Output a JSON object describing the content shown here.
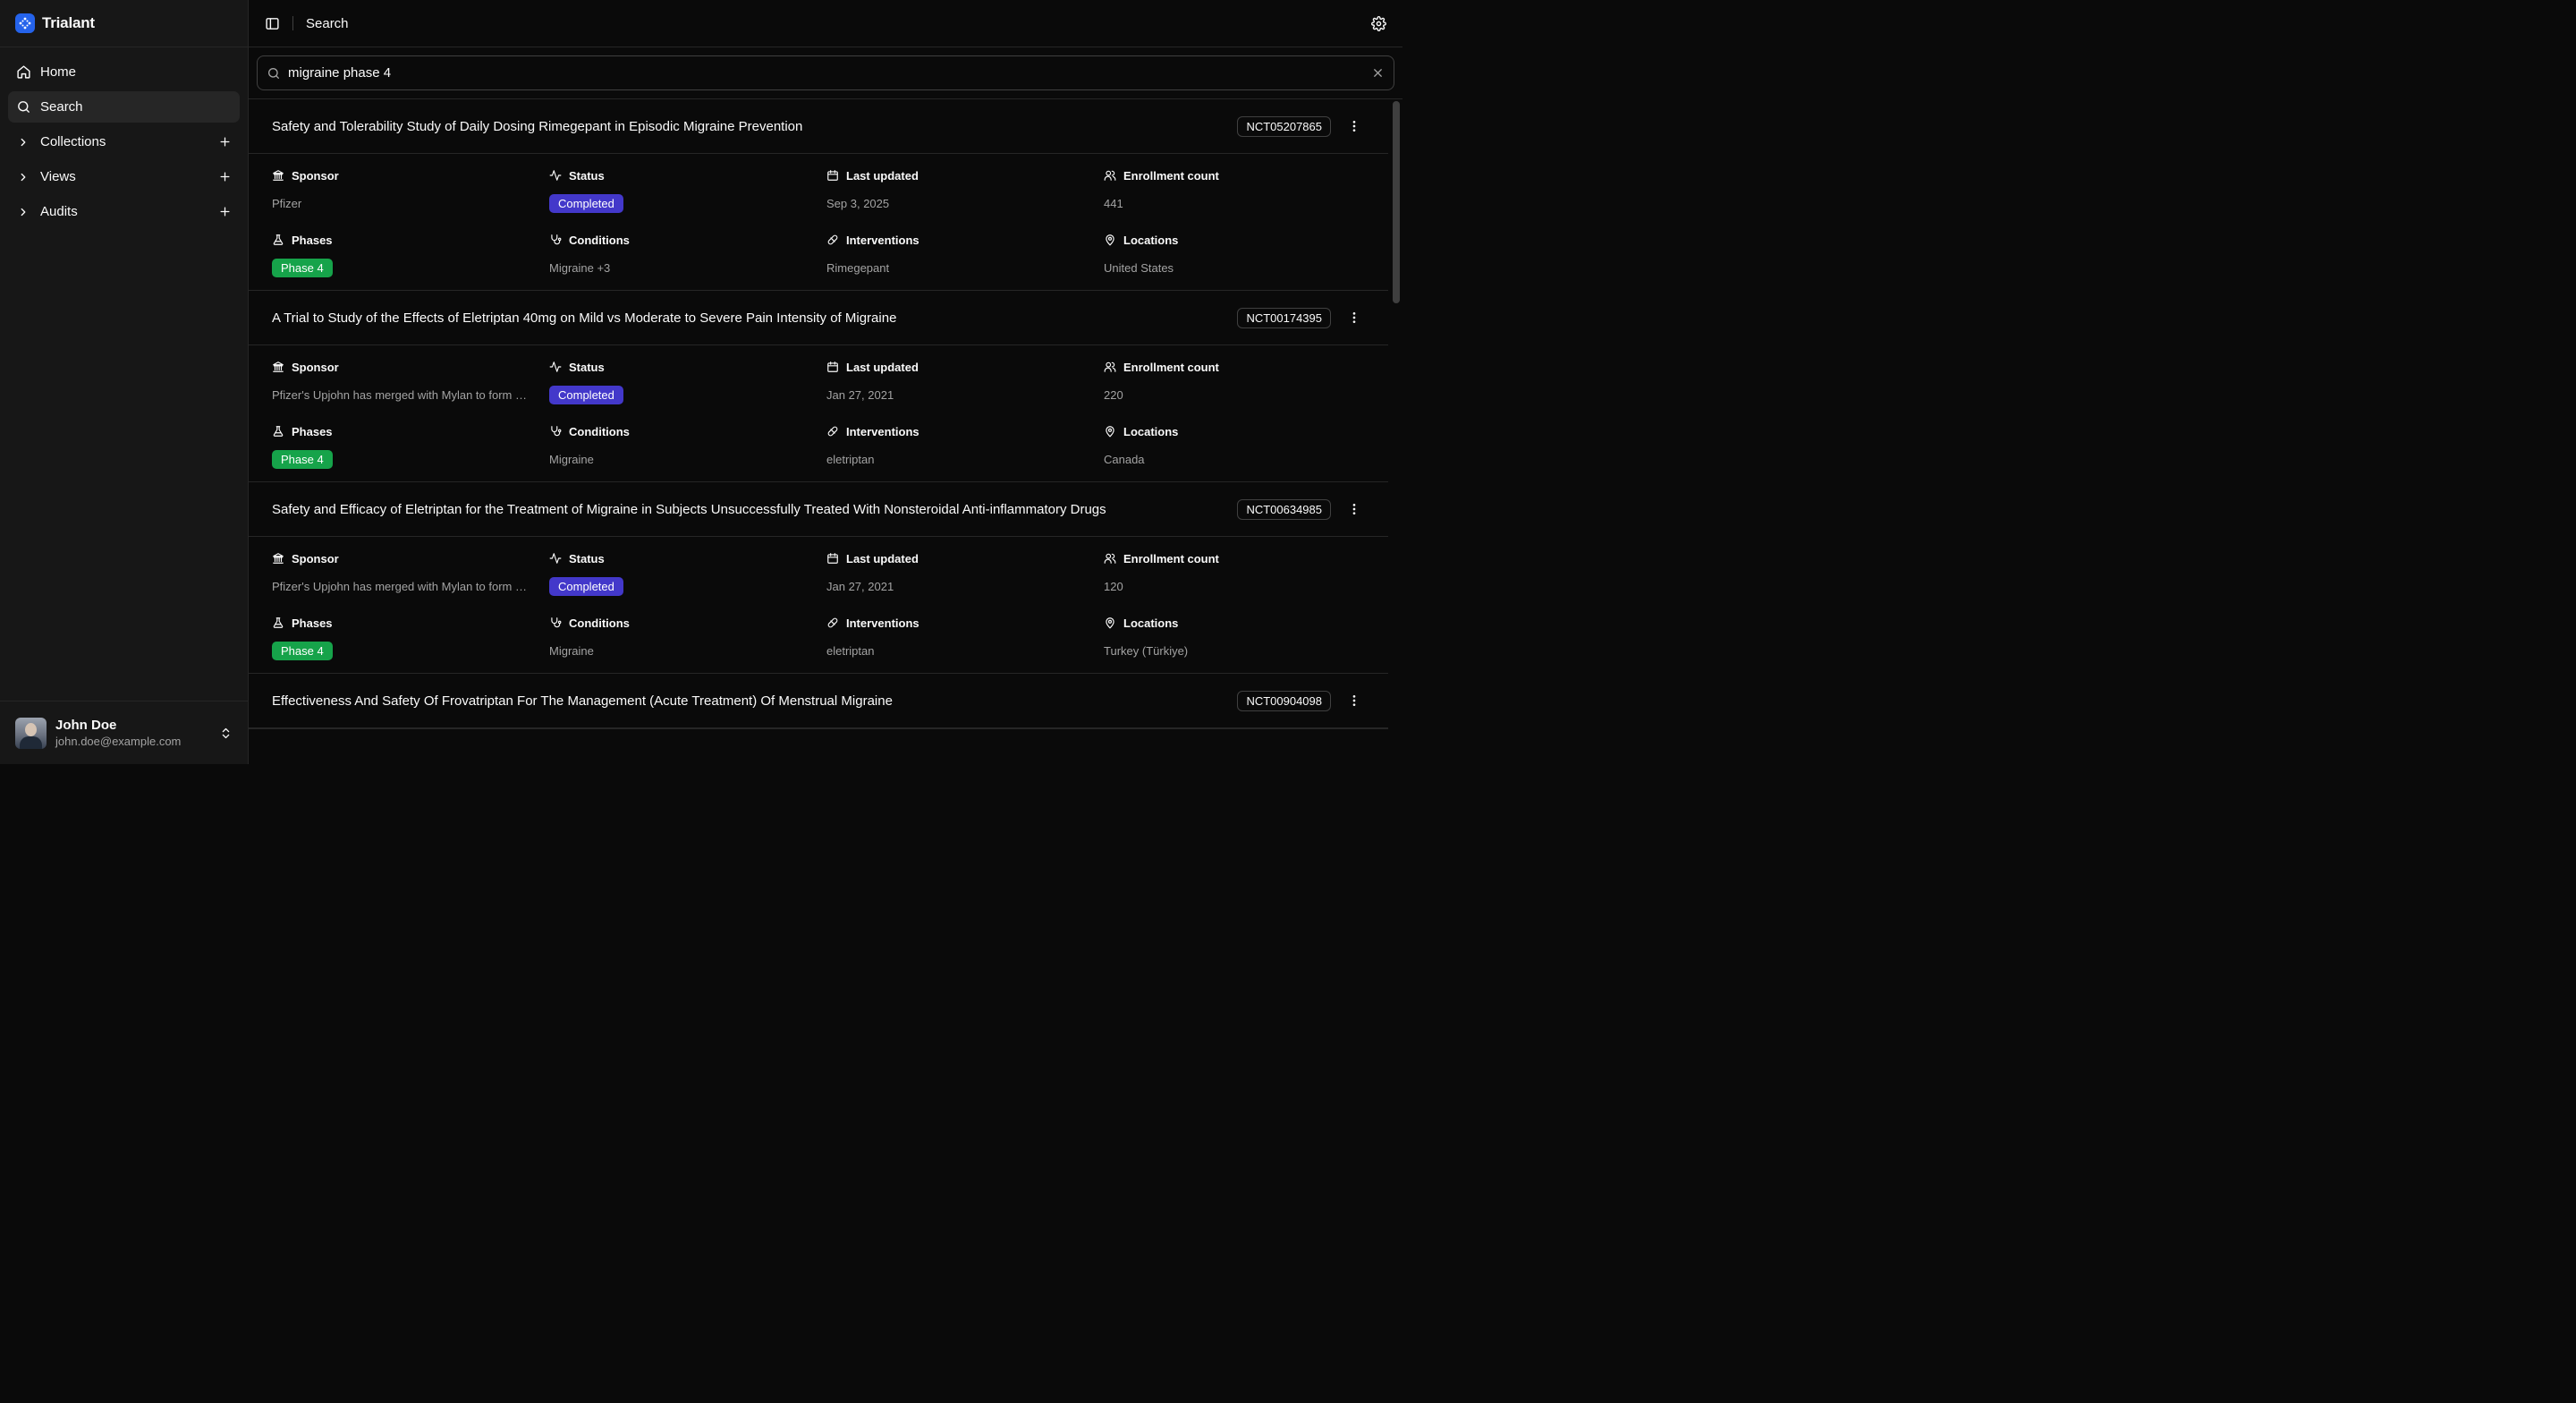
{
  "brand": {
    "name": "Trialant"
  },
  "sidebar": {
    "items": [
      {
        "label": "Home",
        "icon": "home-icon"
      },
      {
        "label": "Search",
        "icon": "search-icon",
        "active": true
      },
      {
        "label": "Collections",
        "icon": "chevron-right-icon",
        "addable": true
      },
      {
        "label": "Views",
        "icon": "chevron-right-icon",
        "addable": true
      },
      {
        "label": "Audits",
        "icon": "chevron-right-icon",
        "addable": true
      }
    ]
  },
  "user": {
    "name": "John Doe",
    "email": "john.doe@example.com"
  },
  "topbar": {
    "title": "Search"
  },
  "search": {
    "value": "migraine phase 4"
  },
  "labels": {
    "sponsor": "Sponsor",
    "status": "Status",
    "last_updated": "Last updated",
    "enrollment": "Enrollment count",
    "phases": "Phases",
    "conditions": "Conditions",
    "interventions": "Interventions",
    "locations": "Locations"
  },
  "results": [
    {
      "title": "Safety and Tolerability Study of Daily Dosing Rimegepant in Episodic Migraine Prevention",
      "nct": "NCT05207865",
      "sponsor": "Pfizer",
      "status": "Completed",
      "last_updated": "Sep 3, 2025",
      "enrollment": "441",
      "phase": "Phase 4",
      "conditions": "Migraine +3",
      "interventions": "Rimegepant",
      "locations": "United States"
    },
    {
      "title": "A Trial to Study of the Effects of Eletriptan 40mg on Mild vs Moderate to Severe Pain Intensity of Migraine",
      "nct": "NCT00174395",
      "sponsor": "Pfizer's Upjohn has merged with Mylan to form …",
      "status": "Completed",
      "last_updated": "Jan 27, 2021",
      "enrollment": "220",
      "phase": "Phase 4",
      "conditions": "Migraine",
      "interventions": "eletriptan",
      "locations": "Canada"
    },
    {
      "title": "Safety and Efficacy of Eletriptan for the Treatment of Migraine in Subjects Unsuccessfully Treated With Nonsteroidal Anti-inflammatory Drugs",
      "nct": "NCT00634985",
      "sponsor": "Pfizer's Upjohn has merged with Mylan to form …",
      "status": "Completed",
      "last_updated": "Jan 27, 2021",
      "enrollment": "120",
      "phase": "Phase 4",
      "conditions": "Migraine",
      "interventions": "eletriptan",
      "locations": "Turkey (Türkiye)"
    },
    {
      "title": "Effectiveness And Safety Of Frovatriptan For The Management (Acute Treatment) Of Menstrual Migraine",
      "nct": "NCT00904098"
    }
  ]
}
